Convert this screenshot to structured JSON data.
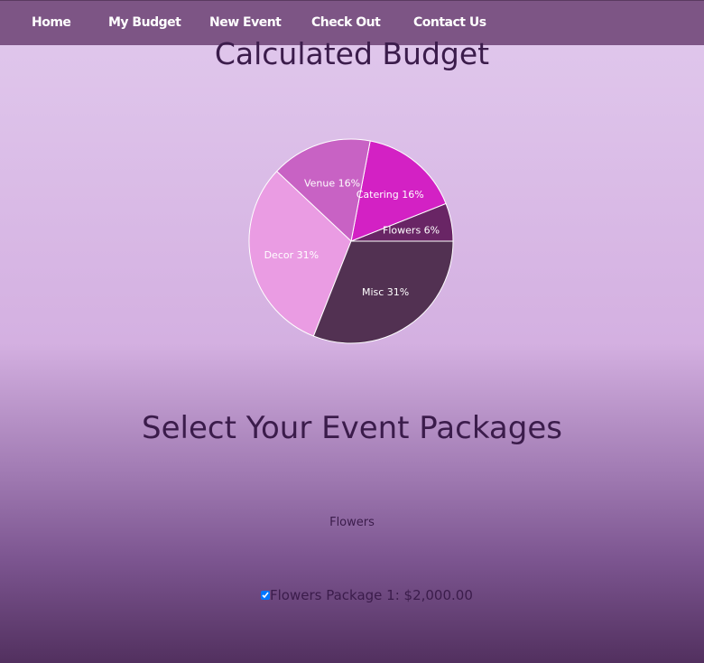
{
  "nav": {
    "items": [
      "Home",
      "My Budget",
      "New Event",
      "Check Out",
      "Contact Us"
    ]
  },
  "budget_title": "Calculated Budget",
  "chart_data": {
    "type": "pie",
    "slices": [
      {
        "label": "Flowers",
        "value": 6,
        "color": "#692565"
      },
      {
        "label": "Catering",
        "value": 16,
        "color": "#d321c4"
      },
      {
        "label": "Venue",
        "value": 16,
        "color": "#c862c4"
      },
      {
        "label": "Decor",
        "value": 31,
        "color": "#ea9ce3"
      },
      {
        "label": "Misc",
        "value": 31,
        "color": "#523152"
      }
    ]
  },
  "packages_title": "Select Your Event Packages",
  "category": "Flowers",
  "package": {
    "label": "Flowers Package 1: $2,000.00",
    "checked": true
  }
}
